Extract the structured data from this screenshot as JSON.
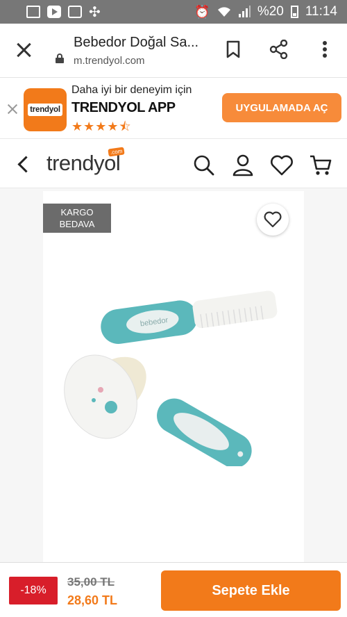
{
  "status_bar": {
    "battery": "%20",
    "time": "11:14"
  },
  "browser": {
    "page_title": "Bebedor Doğal Sa...",
    "url": "m.trendyol.com"
  },
  "app_banner": {
    "logo_text": "trendyol",
    "line1": "Daha iyi bir deneyim için",
    "line2": "TRENDYOL APP",
    "stars": "★★★★⯪",
    "rating": 4.5,
    "cta": "UYGULAMADA AÇ"
  },
  "site_header": {
    "logo": "trendyol",
    "logo_badge": ".com"
  },
  "product": {
    "badge": "KARGO BEDAVA",
    "brand_on_item": "bebedor"
  },
  "bottom_bar": {
    "discount": "-18%",
    "old_price": "35,00 TL",
    "new_price": "28,60 TL",
    "add_to_cart": "Sepete Ekle"
  },
  "colors": {
    "brand_orange": "#f27a1a",
    "discount_red": "#d81e2a",
    "status_bar": "#777777"
  },
  "icons": [
    "image-icon",
    "youtube-icon",
    "package-icon",
    "sync-icon",
    "alarm-icon",
    "wifi-icon",
    "signal-icon",
    "battery-icon",
    "close-icon",
    "lock-icon",
    "bookmark-icon",
    "share-icon",
    "more-icon",
    "back-icon",
    "search-icon",
    "user-icon",
    "heart-icon",
    "cart-icon",
    "favorite-icon"
  ]
}
